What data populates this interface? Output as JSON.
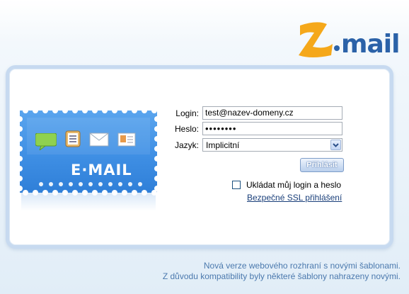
{
  "brand": {
    "logo_text": "Zmail",
    "accent": "#f5a81a",
    "text_color": "#2b62a8"
  },
  "stamp": {
    "title": "E·MAIL",
    "icons": [
      "chat-bubble-icon",
      "notepad-icon",
      "envelope-icon",
      "contact-card-icon"
    ]
  },
  "form": {
    "login_label": "Login:",
    "login_value": "test@nazev-domeny.cz",
    "password_label": "Heslo:",
    "password_value": "••••••••",
    "language_label": "Jazyk:",
    "language_value": "Implicitní",
    "submit_label": "Přihlásit",
    "remember_label": "Ukládat můj login a heslo",
    "remember_checked": false,
    "ssl_link": "Bezpečné SSL přihlášení"
  },
  "notice": {
    "line1": "Nová verze webového rozhraní s novými šablonami.",
    "line2": "Z důvodu kompatibility byly některé šablony nahrazeny novými."
  }
}
